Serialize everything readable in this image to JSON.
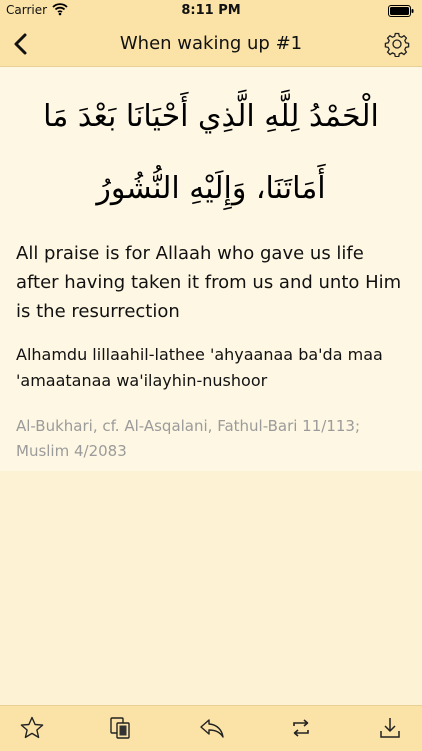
{
  "status": {
    "carrier": "Carrier",
    "time": "8:11 PM"
  },
  "nav": {
    "title": "When waking up #1"
  },
  "dua": {
    "arabic": "الْحَمْدُ لِلَّهِ الَّذِي أَحْيَانَا بَعْدَ مَا أَمَاتَنَا، وَإِلَيْهِ النُّشُورُ",
    "translation": "All praise is for Allaah who gave us life after having taken it from us and unto Him is the resurrection",
    "transliteration": "Alhamdu lillaahil-lathee 'ahyaanaa ba'da maa 'amaatanaa wa'ilayhin-nushoor",
    "reference": "Al-Bukhari, cf. Al-Asqalani, Fathul-Bari 11/113; Muslim 4/2083"
  },
  "toolbar": {
    "icons": [
      "star-icon",
      "copy-icon",
      "share-icon",
      "repeat-icon",
      "download-icon"
    ]
  }
}
